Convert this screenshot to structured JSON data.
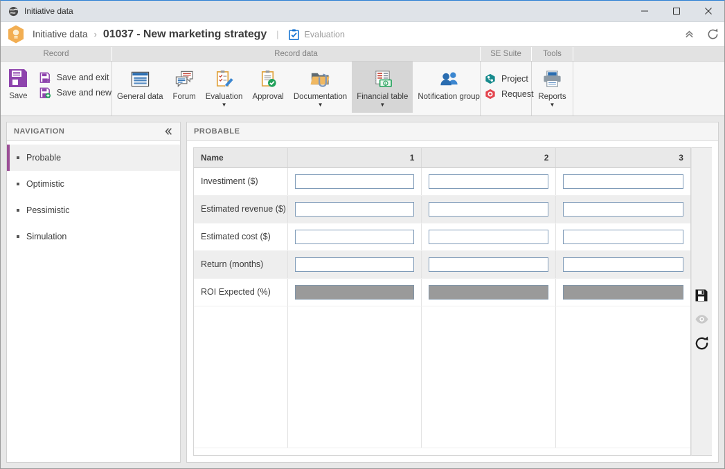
{
  "window": {
    "title": "Initiative data",
    "app_icon": "globe-icon",
    "minimize_label": "Minimize",
    "maximize_label": "Maximize",
    "close_label": "Close"
  },
  "breadcrumb": {
    "module_icon": "lightbulb-hexagon-icon",
    "root": "Initiative data",
    "separator": "›",
    "title": "01037 - New marketing strategy",
    "divider": "|",
    "status_icon": "clipboard-check-icon",
    "status_label": "Evaluation",
    "collapse_icon": "chevron-double-up-icon",
    "refresh_icon": "refresh-icon"
  },
  "ribbon": {
    "groups": [
      {
        "name": "Record",
        "label": "Record"
      },
      {
        "name": "Record data",
        "label": "Record data"
      },
      {
        "name": "SE Suite",
        "label": "SE Suite"
      },
      {
        "name": "Tools",
        "label": "Tools"
      },
      {
        "name": "empty",
        "label": ""
      }
    ],
    "record": {
      "save": {
        "label": "Save",
        "icon": "floppy-disk-icon"
      },
      "save_and_exit": {
        "label": "Save and exit",
        "icon": "save-exit-icon"
      },
      "save_and_new": {
        "label": "Save and new",
        "icon": "save-new-icon"
      }
    },
    "record_data": [
      {
        "label": "General data",
        "icon": "document-window-icon",
        "caret": false,
        "active": false
      },
      {
        "label": "Forum",
        "icon": "chat-bubbles-icon",
        "caret": false,
        "active": false
      },
      {
        "label": "Evaluation",
        "icon": "clipboard-pencil-icon",
        "caret": true,
        "active": false
      },
      {
        "label": "Approval",
        "icon": "clipboard-check-green-icon",
        "caret": false,
        "active": false
      },
      {
        "label": "Documentation",
        "icon": "folder-clip-icon",
        "caret": true,
        "active": false
      },
      {
        "label": "Financial table",
        "icon": "money-table-icon",
        "caret": true,
        "active": true
      },
      {
        "label": "Notification group",
        "icon": "people-icon",
        "caret": false,
        "active": false
      }
    ],
    "se_suite": [
      {
        "label": "Project",
        "icon": "project-teal-icon"
      },
      {
        "label": "Request",
        "icon": "request-red-icon"
      }
    ],
    "tools": [
      {
        "label": "Reports",
        "icon": "printer-icon",
        "caret": true
      }
    ]
  },
  "sidebar": {
    "title": "NAVIGATION",
    "collapse_icon": "chevron-double-left-icon",
    "items": [
      {
        "label": "Probable",
        "selected": true
      },
      {
        "label": "Optimistic",
        "selected": false
      },
      {
        "label": "Pessimistic",
        "selected": false
      },
      {
        "label": "Simulation",
        "selected": false
      }
    ]
  },
  "main": {
    "panel_title": "PROBABLE",
    "table": {
      "headers": [
        "Name",
        "1",
        "2",
        "3"
      ],
      "rows": [
        {
          "label": "Investiment ($)",
          "type": "input",
          "values": [
            "",
            "",
            ""
          ]
        },
        {
          "label": "Estimated revenue ($)",
          "type": "input",
          "values": [
            "",
            "",
            ""
          ]
        },
        {
          "label": "Estimated cost ($)",
          "type": "input",
          "values": [
            "",
            "",
            ""
          ]
        },
        {
          "label": "Return (months)",
          "type": "input",
          "values": [
            "",
            "",
            ""
          ]
        },
        {
          "label": "ROI Expected (%)",
          "type": "readonly",
          "values": [
            "",
            "",
            ""
          ]
        }
      ]
    },
    "side_tools": [
      {
        "name": "save",
        "icon": "floppy-disk-icon",
        "enabled": true
      },
      {
        "name": "view",
        "icon": "eye-icon",
        "enabled": false
      },
      {
        "name": "refresh",
        "icon": "refresh-icon",
        "enabled": true
      }
    ]
  },
  "colors": {
    "accent_purple": "#9b4f96",
    "accent_blue": "#2a7fd4",
    "title_bar": "#dfe3e8",
    "ribbon_group_bar": "#e2e2e2",
    "ribbon_body": "#f7f7f7",
    "content_bg": "#e8e8e8",
    "input_border": "#7f9bb8",
    "readonly_fill": "#9a9a9a",
    "hex_orange": "#f0ad4e"
  }
}
